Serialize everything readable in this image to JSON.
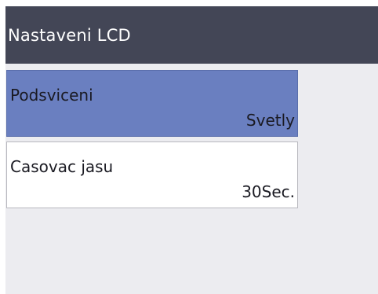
{
  "header": {
    "title": "Nastaveni LCD"
  },
  "menu": {
    "items": [
      {
        "label": "Podsviceni",
        "value": "Svetly"
      },
      {
        "label": "Casovac jasu",
        "value": "30Sec."
      }
    ]
  },
  "colors": {
    "header_background": "#434656",
    "selected_item": "#6a7fc0",
    "screen_background": "#ececf0"
  }
}
